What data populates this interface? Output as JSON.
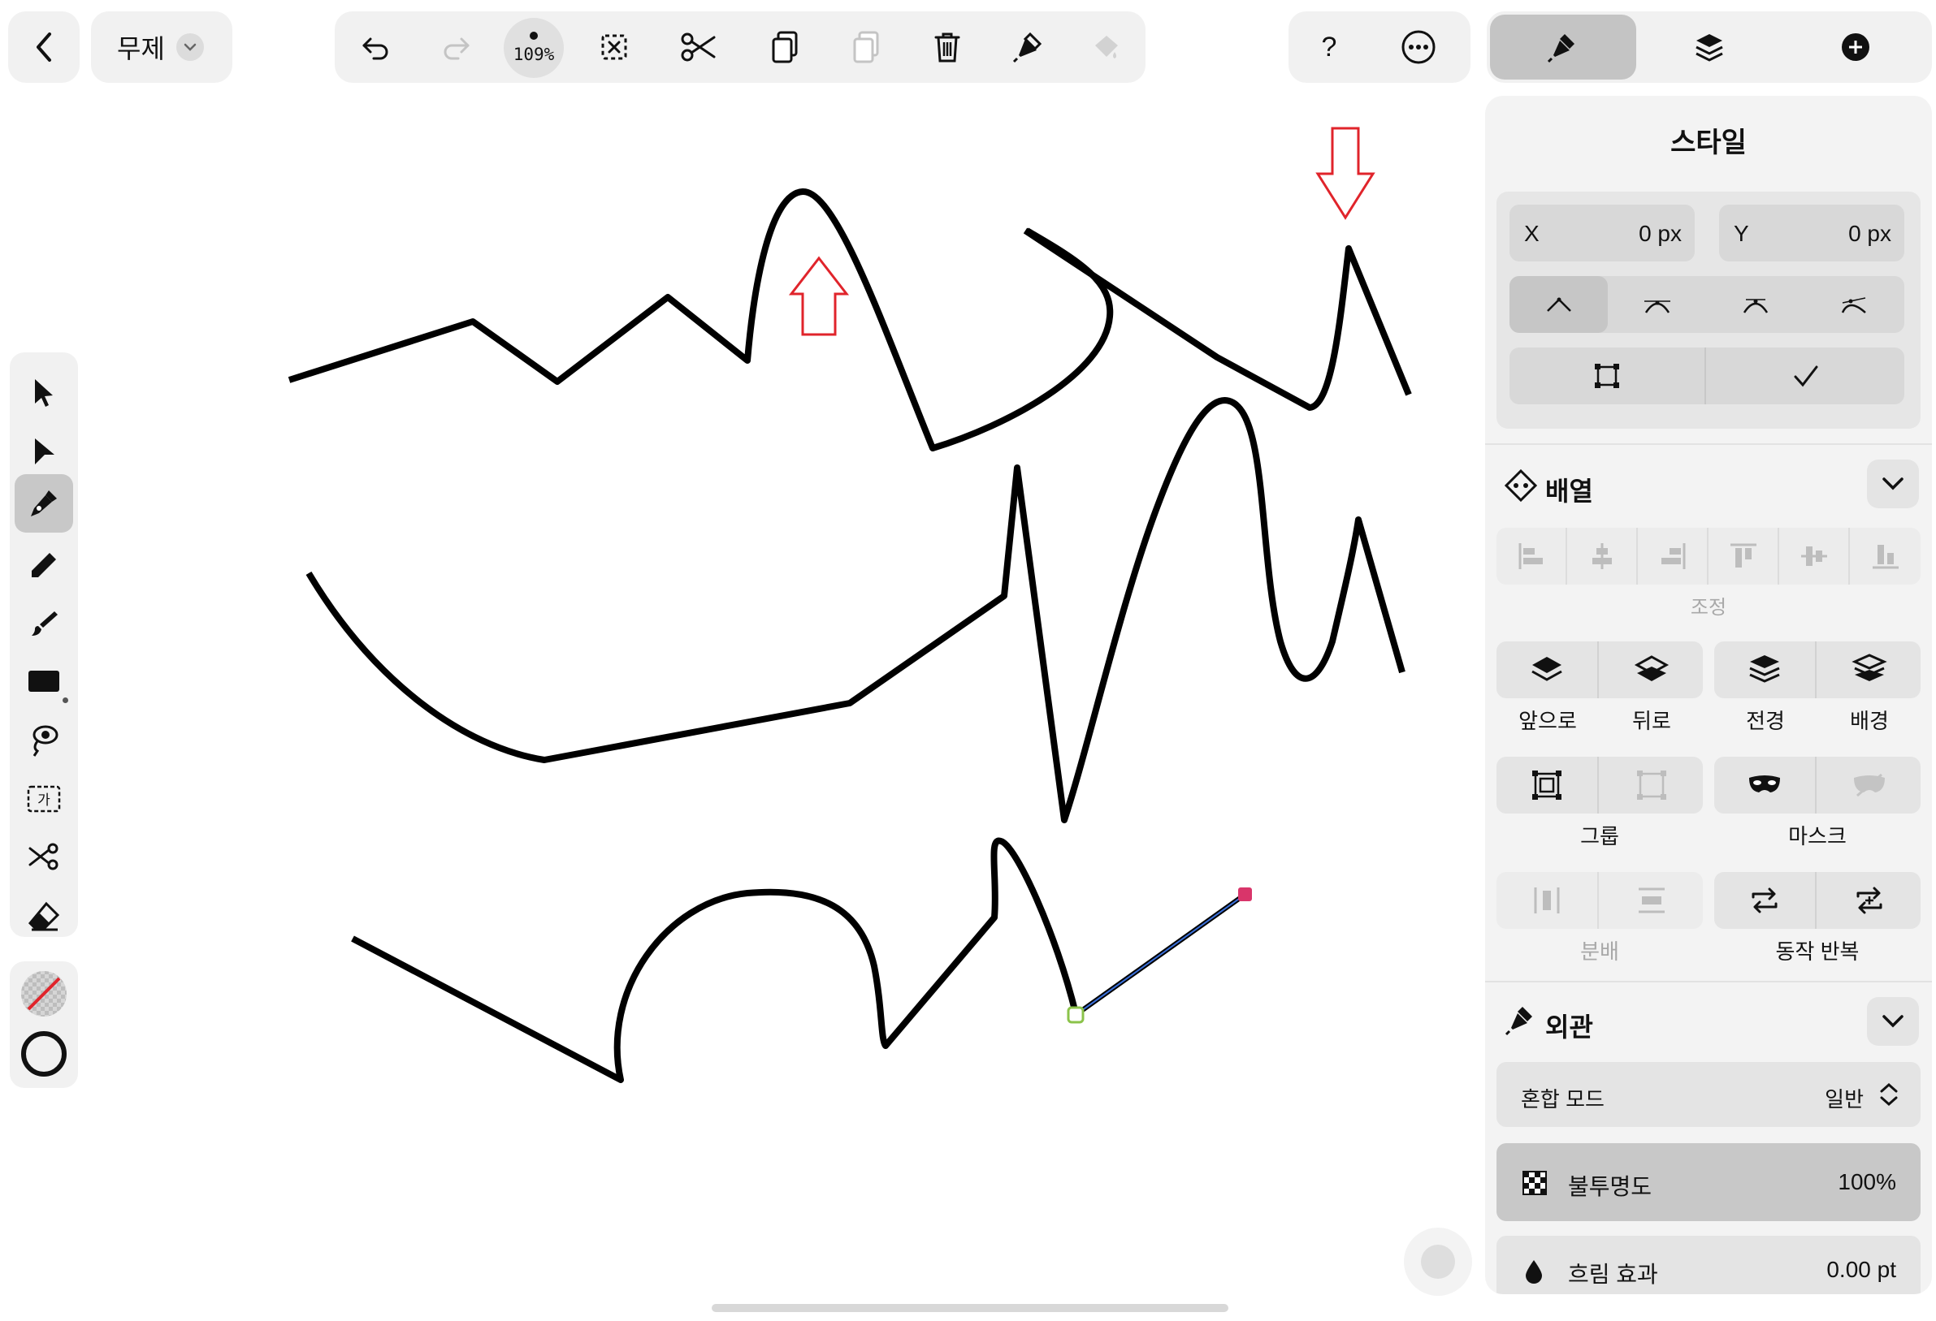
{
  "document": {
    "title": "무제"
  },
  "toolbar": {
    "zoom": "109%"
  },
  "inspector": {
    "tabs": [
      "style",
      "layers",
      "add"
    ],
    "title": "스타일",
    "x_label": "X",
    "x_value": "0 px",
    "y_label": "Y",
    "y_value": "0 px",
    "arrange": {
      "title": "배열",
      "adjust_label": "조정",
      "front_label": "앞으로",
      "back_label": "뒤로",
      "foreground_label": "전경",
      "background_label": "배경",
      "group_label": "그룹",
      "mask_label": "마스크",
      "distribute_label": "분배",
      "repeat_label": "동작 반복"
    },
    "appearance": {
      "title": "외관",
      "blend_label": "혼합 모드",
      "blend_value": "일반",
      "opacity_label": "불투명도",
      "opacity_value": "100%",
      "blur_label": "흐림 효과",
      "blur_value": "0.00 pt"
    }
  },
  "colors": {
    "accent_red": "#e0242b",
    "anchor_pink": "#d9356a",
    "anchor_green": "#8bc34a",
    "selection_blue": "#3a6fd8"
  },
  "tools": [
    "select",
    "direct-select",
    "pen",
    "pencil",
    "brush",
    "shape",
    "lasso-fill",
    "text",
    "scissors",
    "eraser"
  ]
}
